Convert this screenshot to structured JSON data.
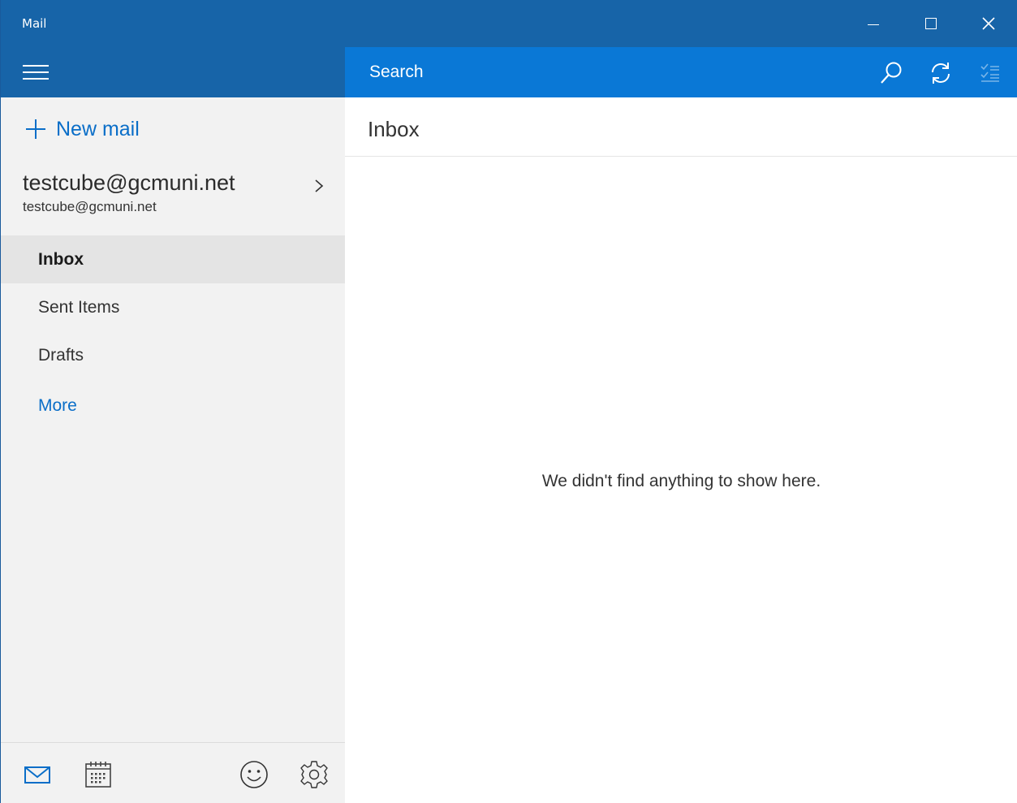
{
  "window": {
    "title": "Mail"
  },
  "header": {
    "search_label": "Search"
  },
  "sidebar": {
    "new_mail_label": "New mail",
    "account": {
      "name": "testcube@gcmuni.net",
      "email": "testcube@gcmuni.net"
    },
    "folders": [
      {
        "label": "Inbox",
        "selected": true
      },
      {
        "label": "Sent Items",
        "selected": false
      },
      {
        "label": "Drafts",
        "selected": false
      }
    ],
    "more_label": "More",
    "bottom_icons": [
      "mail-icon",
      "calendar-icon",
      "feedback-smiley-icon",
      "settings-gear-icon"
    ]
  },
  "main": {
    "list_title": "Inbox",
    "empty_message": "We didn't find anything to show here."
  },
  "colors": {
    "titlebar": "#1764a8",
    "search_header": "#0a78d6",
    "accent": "#0a6ec8",
    "sidebar_bg": "#f2f2f2",
    "selected_bg": "#e4e4e4"
  }
}
